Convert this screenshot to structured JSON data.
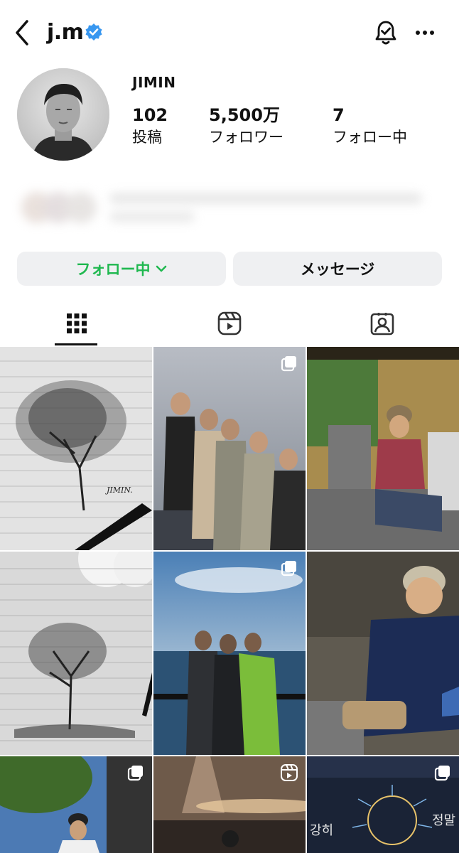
{
  "header": {
    "username": "j.m",
    "back_icon": "chevron-left-icon",
    "verified_icon": "verified-badge-icon",
    "bell_icon": "notification-bell-icon",
    "more_icon": "more-dots-icon"
  },
  "profile": {
    "display_name": "JIMIN",
    "stats": [
      {
        "value": "102",
        "label": "投稿"
      },
      {
        "value": "5,500万",
        "label": "フォロワー"
      },
      {
        "value": "7",
        "label": "フォロー中"
      }
    ]
  },
  "actions": {
    "following_label": "フォロー中",
    "message_label": "メッセージ",
    "following_color": "#1fb84f"
  },
  "tabs": [
    {
      "icon": "grid-icon",
      "active": true
    },
    {
      "icon": "reels-icon",
      "active": false
    },
    {
      "icon": "tagged-icon",
      "active": false
    }
  ],
  "posts": [
    {
      "desc": "pencil sketch of tree",
      "badge": null
    },
    {
      "desc": "group photo of five",
      "badge": "multi"
    },
    {
      "desc": "man sitting on patio",
      "badge": null
    },
    {
      "desc": "pencil sketch of tree 2",
      "badge": null
    },
    {
      "desc": "three men by sea",
      "badge": "multi"
    },
    {
      "desc": "man in beanie seated",
      "badge": null
    },
    {
      "desc": "man outdoors with cap",
      "badge": "multi"
    },
    {
      "desc": "dim room selfie",
      "badge": "reel"
    },
    {
      "desc": "neon sign wall",
      "badge": "multi"
    }
  ],
  "overlay_text": {
    "neon_left": "강히",
    "neon_right": "정말",
    "sketch_signature": "JIMIN."
  }
}
